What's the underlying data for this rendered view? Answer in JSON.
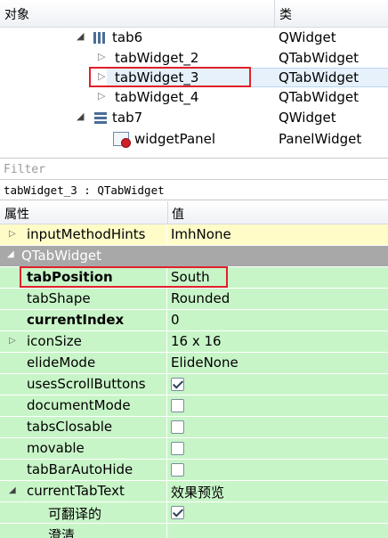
{
  "object_inspector": {
    "col_object": "对象",
    "col_class": "类",
    "rows": [
      {
        "name": "tab6",
        "cls": "QWidget"
      },
      {
        "name": "tabWidget_2",
        "cls": "QTabWidget"
      },
      {
        "name": "tabWidget_3",
        "cls": "QTabWidget"
      },
      {
        "name": "tabWidget_4",
        "cls": "QTabWidget"
      },
      {
        "name": "tab7",
        "cls": "QWidget"
      },
      {
        "name": "widgetPanel",
        "cls": "PanelWidget"
      }
    ]
  },
  "filter": {
    "placeholder": "Filter"
  },
  "object_title": "tabWidget_3 : QTabWidget",
  "property_editor": {
    "col_property": "属性",
    "col_value": "值",
    "rows": [
      {
        "name": "inputMethodHints",
        "value": "ImhNone"
      },
      {
        "name": "QTabWidget"
      },
      {
        "name": "tabPosition",
        "value": "South"
      },
      {
        "name": "tabShape",
        "value": "Rounded"
      },
      {
        "name": "currentIndex",
        "value": "0"
      },
      {
        "name": "iconSize",
        "value": "16 x 16"
      },
      {
        "name": "elideMode",
        "value": "ElideNone"
      },
      {
        "name": "usesScrollButtons",
        "checked": true
      },
      {
        "name": "documentMode",
        "checked": false
      },
      {
        "name": "tabsClosable",
        "checked": false
      },
      {
        "name": "movable",
        "checked": false
      },
      {
        "name": "tabBarAutoHide",
        "checked": false
      },
      {
        "name": "currentTabText",
        "value": "效果预览"
      },
      {
        "name": "可翻译的",
        "checked": true
      },
      {
        "name": "澄清"
      }
    ]
  },
  "colors": {
    "selection_outline": "#e0202a",
    "green_row": "#c8f5c8",
    "yellow_row": "#fffcc8",
    "section_row": "#a8a8a8"
  }
}
